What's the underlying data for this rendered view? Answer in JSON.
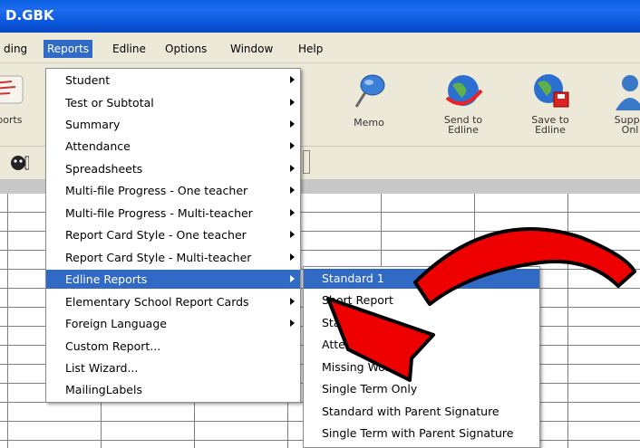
{
  "window": {
    "title": "D.GBK"
  },
  "menubar": [
    {
      "label": "ding"
    },
    {
      "label": "Reports"
    },
    {
      "label": "Edline"
    },
    {
      "label": "Options"
    },
    {
      "label": "Window"
    },
    {
      "label": "Help"
    }
  ],
  "toolbar": {
    "reports_label": "eports",
    "memo_label": "Memo",
    "send_label": "Send to\nEdline",
    "save_label": "Save to\nEdline",
    "support_label": "Suppo\nOnl"
  },
  "reports_menu": {
    "items": [
      {
        "label": "Student"
      },
      {
        "label": "Test or Subtotal"
      },
      {
        "label": "Summary"
      },
      {
        "label": "Attendance"
      },
      {
        "label": "Spreadsheets"
      },
      {
        "label": "Multi-file Progress - One teacher"
      },
      {
        "label": "Multi-file Progress - Multi-teacher"
      },
      {
        "label": "Report Card Style - One teacher"
      },
      {
        "label": "Report Card Style - Multi-teacher"
      },
      {
        "label": "Edline Reports"
      },
      {
        "label": "Elementary School Report Cards"
      },
      {
        "label": "Foreign Language"
      },
      {
        "label": "Custom Report..."
      },
      {
        "label": "List Wizard..."
      },
      {
        "label": "MailingLabels"
      }
    ]
  },
  "edline_submenu": {
    "items": [
      {
        "label": "Standard 1"
      },
      {
        "label": "Short Report"
      },
      {
        "label": "Standard 2"
      },
      {
        "label": "Attendance"
      },
      {
        "label": "Missing Work"
      },
      {
        "label": "Single Term Only"
      },
      {
        "label": "Standard with Parent Signature"
      },
      {
        "label": "Single Term with Parent Signature"
      }
    ]
  },
  "colors": {
    "highlight": "#316ac5",
    "titlebar": "#0a5fe0",
    "arrow": "#ee0000"
  }
}
